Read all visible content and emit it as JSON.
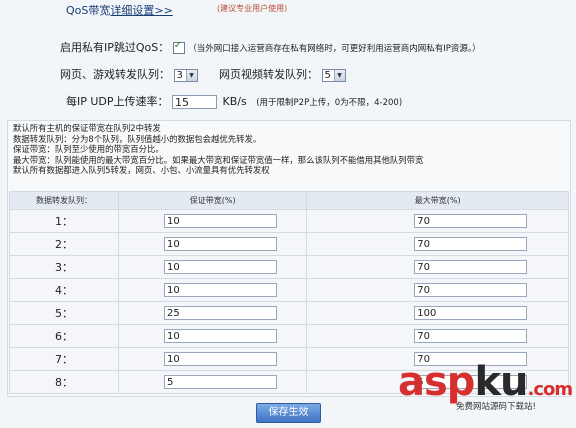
{
  "qos": {
    "prefix": "QoS带宽",
    "link": "详细设置>>",
    "note": "(建议专业用户使用)"
  },
  "private_ip": {
    "label": "启用私有IP跳过QoS：",
    "desc": "（当外网口接入运营商存在私有网络时，可更好利用运营商内网私有IP资源。）"
  },
  "web_game": {
    "label": "网页、游戏转发队列：",
    "value": "3"
  },
  "web_video": {
    "label": "网页视频转发队列：",
    "value": "5"
  },
  "udp": {
    "label": "每IP UDP上传速率：",
    "value": "15",
    "unit": "KB/s",
    "note": "(用于限制P2P上传，0为不限，4-200)"
  },
  "description": [
    "默认所有主机的保证带宽在队列2中转发",
    "数据转发队列：分为8个队列，队列值越小的数据包会越优先转发。",
    "保证带宽：队列至少使用的带宽百分比。",
    "最大带宽：队列能使用的最大带宽百分比。如果最大带宽和保证带宽值一样，那么该队列不能借用其他队列带宽",
    "默认所有数据都进入队列5转发，网页、小包、小流量具有优先转发权"
  ],
  "table": {
    "headers": [
      "数据转发队列：",
      "保证带宽(%)",
      "最大带宽(%)"
    ],
    "rows": [
      {
        "queue": "1：",
        "guaranteed": "10",
        "max": "70"
      },
      {
        "queue": "2：",
        "guaranteed": "10",
        "max": "70"
      },
      {
        "queue": "3：",
        "guaranteed": "10",
        "max": "70"
      },
      {
        "queue": "4：",
        "guaranteed": "10",
        "max": "70"
      },
      {
        "queue": "5：",
        "guaranteed": "25",
        "max": "100"
      },
      {
        "queue": "6：",
        "guaranteed": "10",
        "max": "70"
      },
      {
        "queue": "7：",
        "guaranteed": "10",
        "max": "70"
      },
      {
        "queue": "8：",
        "guaranteed": "5",
        "max": "5"
      }
    ]
  },
  "save_label": "保存生效",
  "watermark": {
    "text_a": "asp",
    "text_k": "ku",
    "text_tail": ".com",
    "sub": "免费网站源码下载站!"
  }
}
